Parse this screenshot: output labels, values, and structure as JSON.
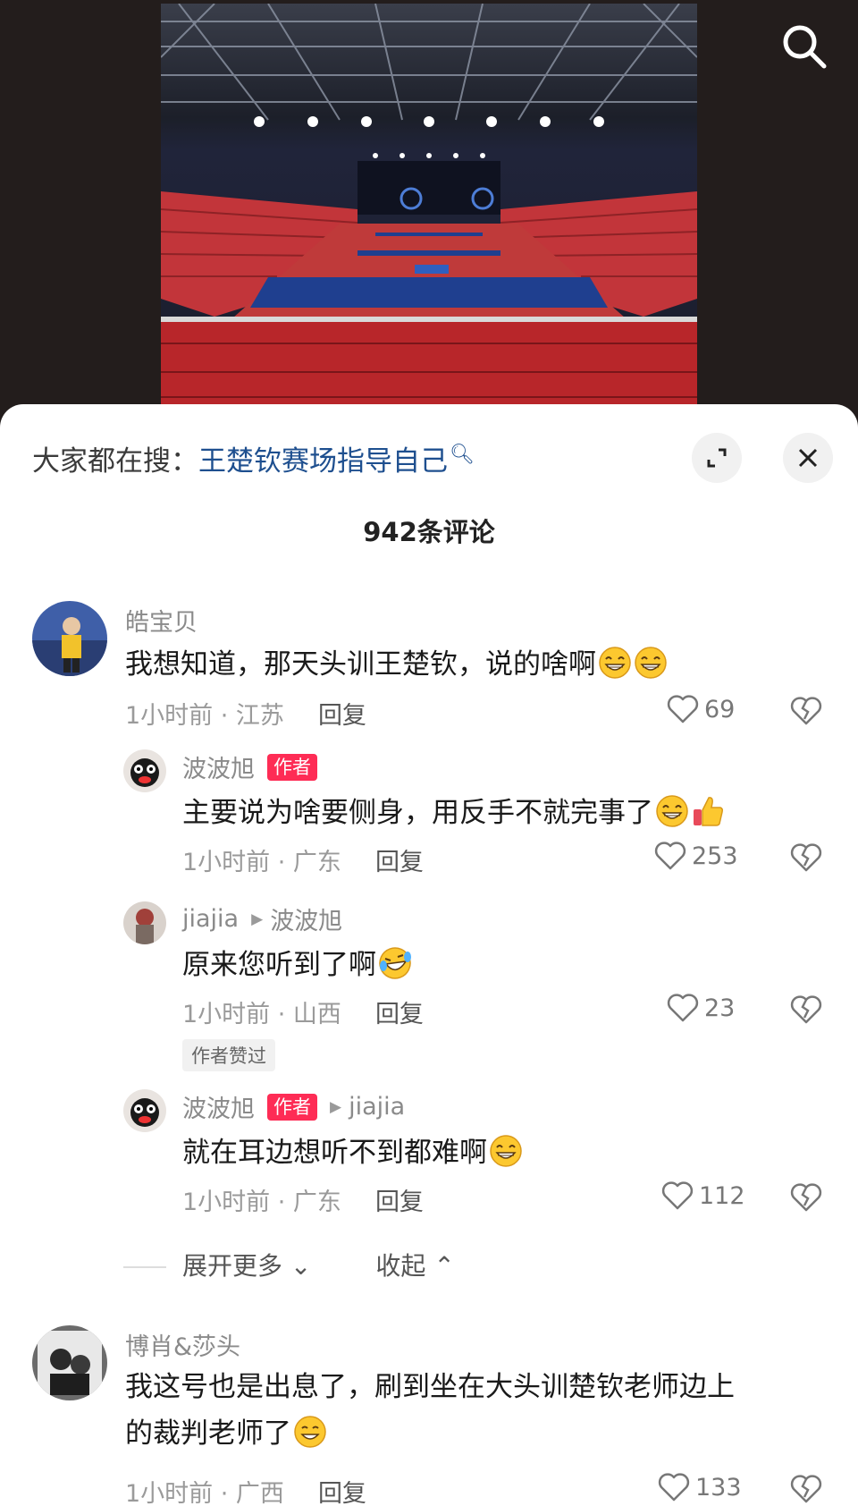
{
  "search_icon": "search-icon",
  "sheet": {
    "suggest_prefix": "大家都在搜：",
    "suggest_keyword": "王楚钦赛场指导自己",
    "comment_count": "942条评论"
  },
  "comments": [
    {
      "user": "皓宝贝",
      "text": "我想知道，那天头训王楚钦，说的啥啊",
      "time_loc": "1小时前 · 江苏",
      "reply": "回复",
      "likes": "69"
    },
    {
      "user": "波波旭",
      "tag": "作者",
      "text": "主要说为啥要侧身，用反手不就完事了",
      "time_loc": "1小时前 · 广东",
      "reply": "回复",
      "likes": "253"
    },
    {
      "user": "jiajia",
      "reply_to": "波波旭",
      "text": "原来您听到了啊",
      "time_loc": "1小时前 · 山西",
      "reply": "回复",
      "likes": "23",
      "liked_by_author": "作者赞过"
    },
    {
      "user": "波波旭",
      "tag": "作者",
      "reply_to": "jiajia",
      "text": "就在耳边想听不到都难啊",
      "time_loc": "1小时前 · 广东",
      "reply": "回复",
      "likes": "112"
    },
    {
      "user": "博肖&莎头",
      "text_line1": "我这号也是出息了，刷到坐在大头训楚钦老师边上",
      "text_line2": "的裁判老师了",
      "time_loc": "1小时前 · 广西",
      "reply": "回复",
      "likes": "133"
    }
  ],
  "thread": {
    "expand_more": "展开更多",
    "collapse": "收起"
  },
  "colors": {
    "accent": "#fe2c55",
    "link": "#1e4f8f",
    "background_dark": "#211c1b"
  }
}
